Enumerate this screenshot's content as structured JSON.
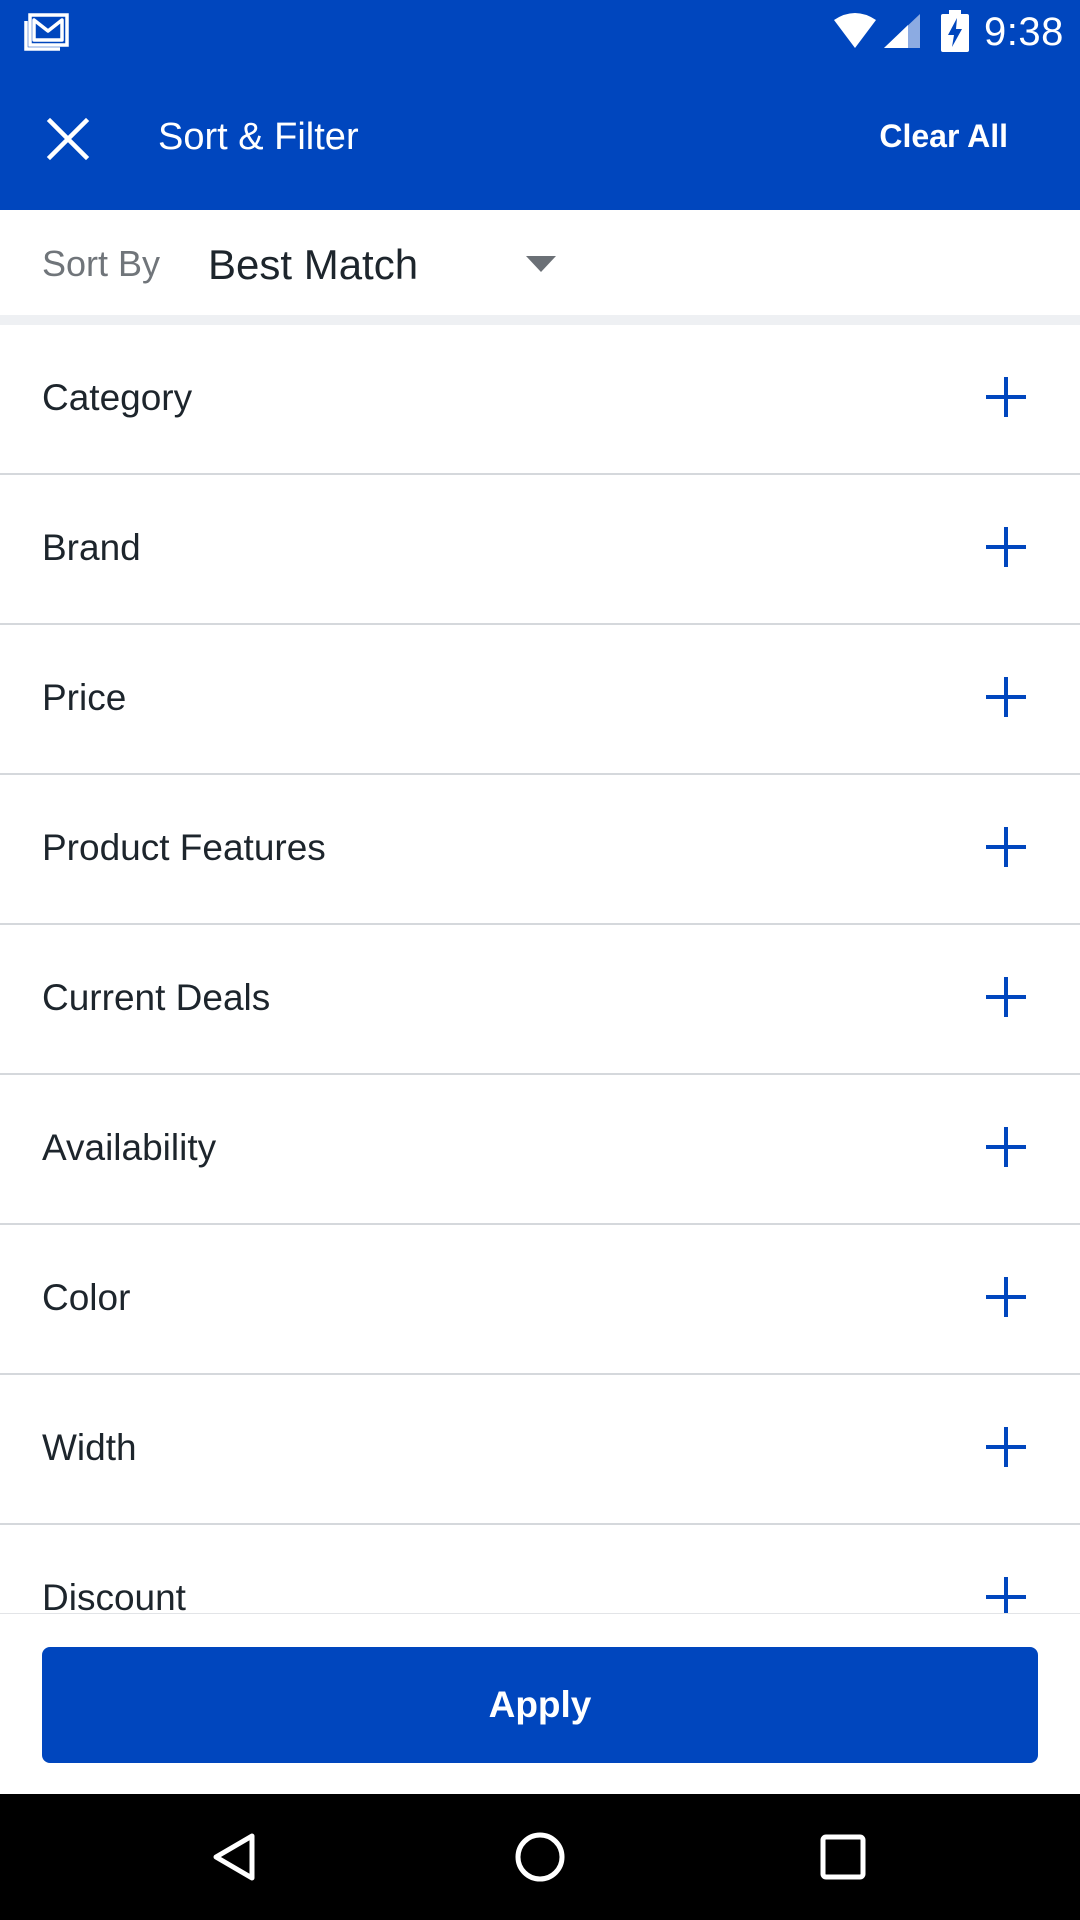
{
  "status_bar": {
    "time": "9:38",
    "icons": [
      "gmail-icon",
      "wifi-icon",
      "cell-signal-icon",
      "battery-charging-icon"
    ]
  },
  "app_bar": {
    "close_icon": "close-icon",
    "title": "Sort & Filter",
    "clear_all_label": "Clear All"
  },
  "sort": {
    "label": "Sort By",
    "selected_value": "Best Match",
    "dropdown_icon": "caret-down-icon"
  },
  "filters": [
    {
      "label": "Category",
      "icon": "plus-icon"
    },
    {
      "label": "Brand",
      "icon": "plus-icon"
    },
    {
      "label": "Price",
      "icon": "plus-icon"
    },
    {
      "label": "Product Features",
      "icon": "plus-icon"
    },
    {
      "label": "Current Deals",
      "icon": "plus-icon"
    },
    {
      "label": "Availability",
      "icon": "plus-icon"
    },
    {
      "label": "Color",
      "icon": "plus-icon"
    },
    {
      "label": "Width",
      "icon": "plus-icon"
    },
    {
      "label": "Discount",
      "icon": "plus-icon"
    }
  ],
  "apply_label": "Apply",
  "nav_bar": {
    "buttons": [
      "back-icon",
      "home-icon",
      "recents-icon"
    ]
  },
  "colors": {
    "brand_blue": "#0046be",
    "text_primary": "#1d252c",
    "text_secondary": "#70757a",
    "divider": "#d5d8dc",
    "section_gap": "#eef0f3",
    "nav_bar": "#000000"
  }
}
